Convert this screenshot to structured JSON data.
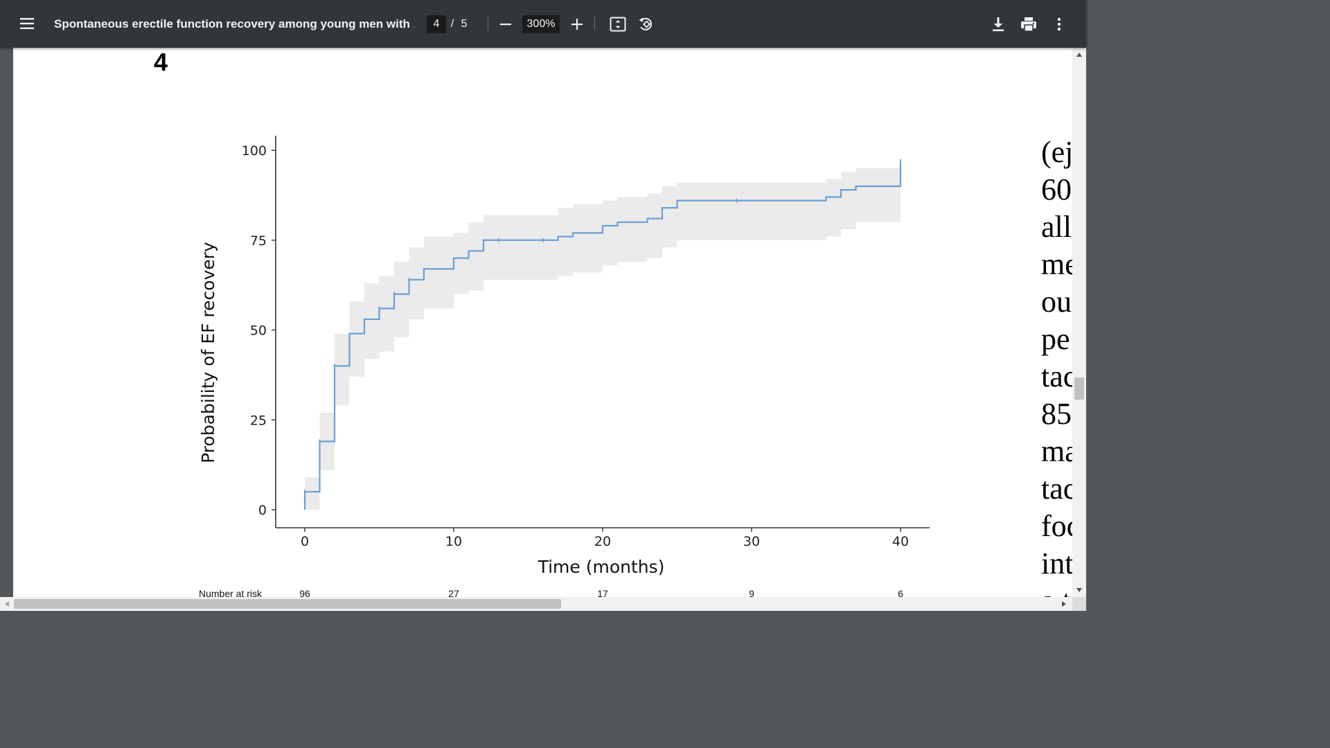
{
  "toolbar": {
    "title": "Spontaneous erectile function recovery among young men with ...",
    "page_current": "4",
    "page_separator": "/",
    "page_total": "5",
    "zoom": "300%",
    "icons": [
      "menu-icon",
      "zoom-out-icon",
      "zoom-in-icon",
      "fit-page-icon",
      "rotate-icon",
      "download-icon",
      "print-icon",
      "more-icon"
    ]
  },
  "document": {
    "figure_number": "4",
    "side_text_fragments": [
      "(ej",
      "60",
      "all",
      "me",
      "ou",
      "pe",
      "tac",
      "85",
      "ma",
      "tac",
      "foc",
      "int",
      "a.t"
    ]
  },
  "chart_data": {
    "type": "line",
    "title": "",
    "xlabel": "Time (months)",
    "ylabel": "Probability of EF recovery",
    "xlim": [
      0,
      40
    ],
    "ylim": [
      0,
      100
    ],
    "xticks": [
      0,
      10,
      20,
      30,
      40
    ],
    "yticks": [
      0,
      25,
      50,
      75,
      100
    ],
    "grid": false,
    "step": true,
    "series": [
      {
        "color": "#6a9fd4",
        "x": [
          0,
          1,
          2,
          3,
          4,
          5,
          6,
          7,
          8,
          10,
          11,
          12,
          17,
          18,
          20,
          21,
          23,
          24,
          25,
          35,
          36,
          37,
          40
        ],
        "y": [
          5,
          19,
          40,
          49,
          53,
          56,
          60,
          64,
          67,
          70,
          72,
          75,
          76,
          77,
          79,
          80,
          81,
          84,
          86,
          87,
          89,
          90,
          97
        ],
        "ci_lower": [
          0,
          11,
          29,
          37,
          42,
          44,
          48,
          53,
          56,
          60,
          61,
          64,
          65,
          66,
          68,
          69,
          70,
          73,
          75,
          76,
          78,
          80,
          80
        ],
        "ci_upper": [
          9,
          27,
          49,
          58,
          63,
          65,
          69,
          73,
          76,
          77,
          80,
          82,
          84,
          85,
          86,
          87,
          88,
          90,
          91,
          92,
          94,
          95,
          95
        ],
        "censor_marks": [
          [
            0,
            5
          ],
          [
            1,
            19
          ],
          [
            2,
            40
          ],
          [
            5,
            56
          ],
          [
            6,
            60
          ],
          [
            7,
            64
          ],
          [
            13,
            75
          ],
          [
            16,
            75
          ],
          [
            29,
            86
          ],
          [
            40,
            97
          ]
        ]
      }
    ],
    "risk_table": {
      "label": "Number at risk",
      "times": [
        0,
        10,
        20,
        30,
        40
      ],
      "counts": [
        "96",
        "27",
        "17",
        "9",
        "6"
      ]
    },
    "ci_fill_color": "#ebebeb",
    "axis_color": "#333333"
  }
}
